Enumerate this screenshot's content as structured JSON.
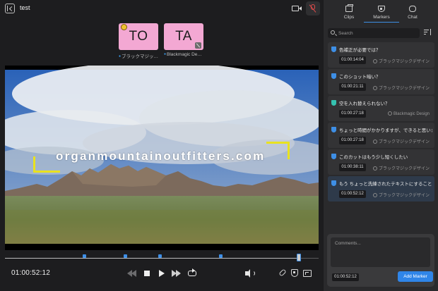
{
  "header": {
    "title": "test",
    "back_icon": "sidebar-collapse-icon",
    "camera_icon": "video-camera-icon",
    "mic_icon": "mic-muted-icon",
    "mic_color": "#e04a4a"
  },
  "participants": [
    {
      "initials": "TO",
      "name": "ブラックマジックデザイン",
      "badge_icon": "host-crown-icon",
      "tile_color": "#f3a8d3"
    },
    {
      "initials": "TA",
      "name": "Blackmagic Design",
      "badge_icon": "mic-muted-icon",
      "tile_color": "#f3a8d3"
    }
  ],
  "video": {
    "watermark_text": "organmountainoutfitters.com",
    "guide_color": "#e9e21f"
  },
  "timeline": {
    "progress_fraction": 0.938,
    "marker_positions": [
      0.252,
      0.382,
      0.493,
      0.688,
      0.938
    ],
    "marker_color": "#3e8fe6"
  },
  "transport": {
    "timecode": "01:00:52:12",
    "icons": [
      "skip-back-icon",
      "stop-icon",
      "play-icon",
      "skip-forward-icon",
      "loop-icon",
      "volume-icon",
      "link-icon",
      "marker-icon",
      "fullscreen-icon"
    ]
  },
  "tabs": [
    {
      "label": "Clips",
      "icon": "clips-icon",
      "active": false
    },
    {
      "label": "Markers",
      "icon": "markers-icon",
      "active": true
    },
    {
      "label": "Chat",
      "icon": "chat-icon",
      "active": false
    }
  ],
  "search": {
    "placeholder": "Search",
    "value": ""
  },
  "markers": [
    {
      "title": "色補正が必要では？",
      "timecode": "01:00:14:04",
      "author": "ブラックマジックデザイン",
      "color": "#3e8fe6",
      "selected": false
    },
    {
      "title": "このショット暗い？",
      "timecode": "01:00:21:11",
      "author": "ブラックマジックデザイン",
      "color": "#3e8fe6",
      "selected": false
    },
    {
      "title": "空を入れ替えられない？",
      "timecode": "01:00:27:18",
      "author": "Blackmagic Design",
      "color": "#35c2b0",
      "selected": false
    },
    {
      "title": "ちょっと時間がかかりますが、できると思いま…",
      "timecode": "01:00:27:18",
      "author": "ブラックマジックデザイン",
      "color": "#3e8fe6",
      "selected": false
    },
    {
      "title": "このカットはもう少し短くしたい",
      "timecode": "01:00:38:11",
      "author": "ブラックマジックデザイン",
      "color": "#3e8fe6",
      "selected": false
    },
    {
      "title": "もう ちょっと洗練されたテキストにすること",
      "timecode": "01:00:52:12",
      "author": "ブラックマジックデザイン",
      "color": "#3e8fe6",
      "selected": true
    }
  ],
  "comment": {
    "placeholder": "Comments...",
    "value": "",
    "timecode": "01:00:52:12",
    "add_label": "Add Marker",
    "accent": "#2f85e8"
  }
}
